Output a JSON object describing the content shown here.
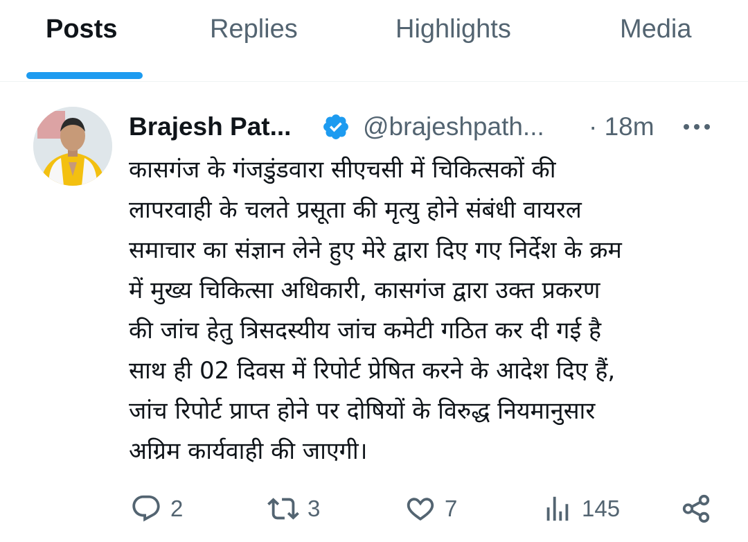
{
  "tabs": [
    {
      "label": "Posts",
      "active": true
    },
    {
      "label": "Replies",
      "active": false
    },
    {
      "label": "Highlights",
      "active": false
    },
    {
      "label": "Media",
      "active": false
    }
  ],
  "colors": {
    "accent": "#1d9bf0",
    "text_primary": "#0f1419",
    "text_secondary": "#536471"
  },
  "post": {
    "author_name": "Brajesh Pat...",
    "verified": true,
    "handle": "@brajeshpath...",
    "time": "· 18m",
    "text_lines": [
      "कासगंज के गंजडुंडवारा सीएचसी में चिकित्सकों की",
      "लापरवाही के चलते प्रसूता की मृत्यु होने संबंधी वायरल",
      "समाचार का संज्ञान लेने हुए मेरे द्वारा दिए गए निर्देश के क्रम",
      "में मुख्य चिकित्सा अधिकारी, कासगंज द्वारा उक्त प्रकरण",
      "की जांच हेतु  त्रिसदस्यीय जांच कमेटी गठित कर दी गई है",
      "साथ ही 02 दिवस में रिपोर्ट प्रेषित करने के आदेश दिए हैं,",
      "जांच रिपोर्ट प्राप्त होने पर दोषियों  के विरुद्ध नियमानुसार",
      "अग्रिम कार्यवाही की जाएगी।"
    ],
    "actions": {
      "reply": {
        "icon": "reply-icon",
        "count": "2"
      },
      "repost": {
        "icon": "repost-icon",
        "count": "3"
      },
      "like": {
        "icon": "heart-icon",
        "count": "7"
      },
      "views": {
        "icon": "analytics-icon",
        "count": "145"
      },
      "share": {
        "icon": "share-icon"
      }
    }
  }
}
